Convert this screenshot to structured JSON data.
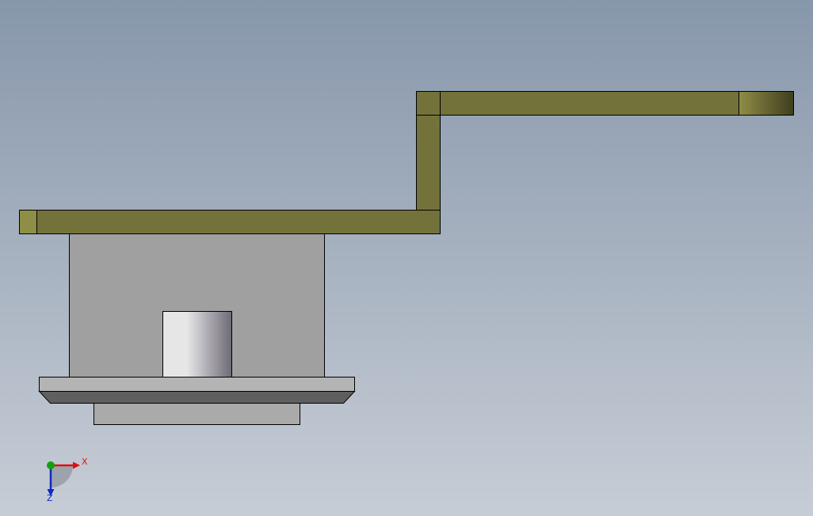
{
  "colors": {
    "background_top": "#8797AB",
    "background_bottom": "#C7CDD6",
    "bracket": "#73723B",
    "bracket_end_light": "#8F8E46",
    "bracket_end_dark": "#3F3D1F",
    "housing": "#A0A0A0",
    "flange_top": "#B4B4B4",
    "flange_bevel": "#5F5F5F",
    "base": "#AAAAAA",
    "shaft_light": "#E6E6E6",
    "shaft_dark": "#6E6A77",
    "outline": "#000000",
    "axis_x": "#E01010",
    "axis_y": "#10A010",
    "axis_z": "#1028C0"
  },
  "triad": {
    "x_label": "X",
    "z_label": "Z"
  }
}
